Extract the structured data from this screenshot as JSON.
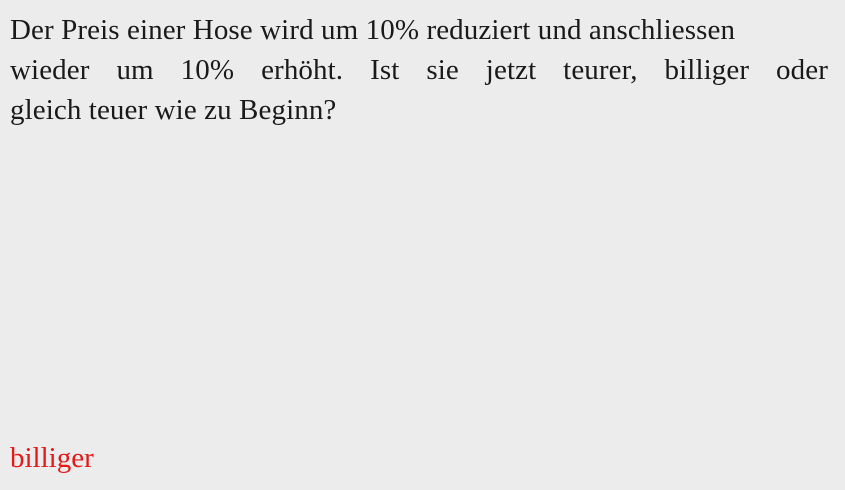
{
  "question": {
    "lines": [
      "Der Preis einer Hose wird um 10% reduziert und anschliessen",
      "wieder um 10% erhöht. Ist sie jetzt teurer, billiger oder",
      "gleich teuer wie zu Beginn?"
    ]
  },
  "answer": {
    "text": "billiger",
    "color": "#e41a1a"
  }
}
